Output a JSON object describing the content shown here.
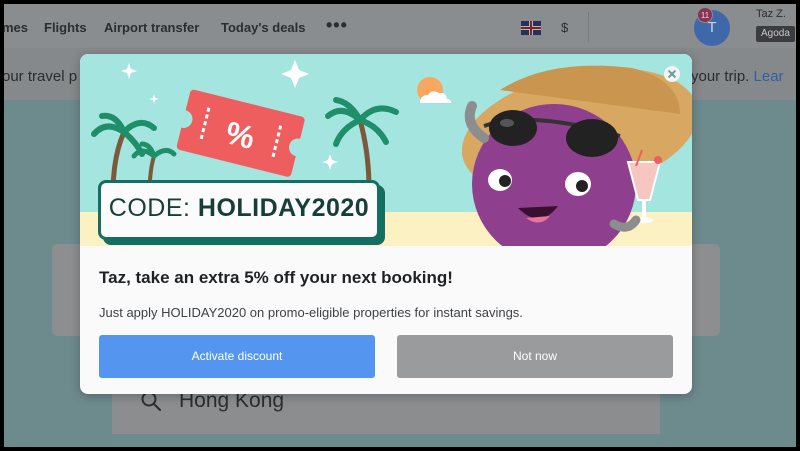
{
  "nav": {
    "items": [
      "mes",
      "Flights",
      "Airport transfer",
      "Today's deals"
    ],
    "more": "•••",
    "currency": "$",
    "user": {
      "initial": "T",
      "badge_count": "11",
      "name": "Taz Z.",
      "tag": "Agoda"
    }
  },
  "banner": {
    "left_text": "our travel p",
    "right_text": "your trip. ",
    "right_link": "Lear"
  },
  "search": {
    "value": "Hong Kong"
  },
  "modal": {
    "code_label": "CODE: ",
    "code_value": "HOLIDAY2020",
    "title": "Taz, take an extra 5% off your next booking!",
    "description": "Just apply HOLIDAY2020 on promo-eligible properties for instant savings.",
    "primary_button": "Activate discount",
    "secondary_button": "Not now"
  },
  "colors": {
    "primary": "#5495f0",
    "secondary": "#999b9d",
    "code_border": "#146e62",
    "hero_sky": "#a5e5df",
    "ticket": "#ee5e5e"
  }
}
